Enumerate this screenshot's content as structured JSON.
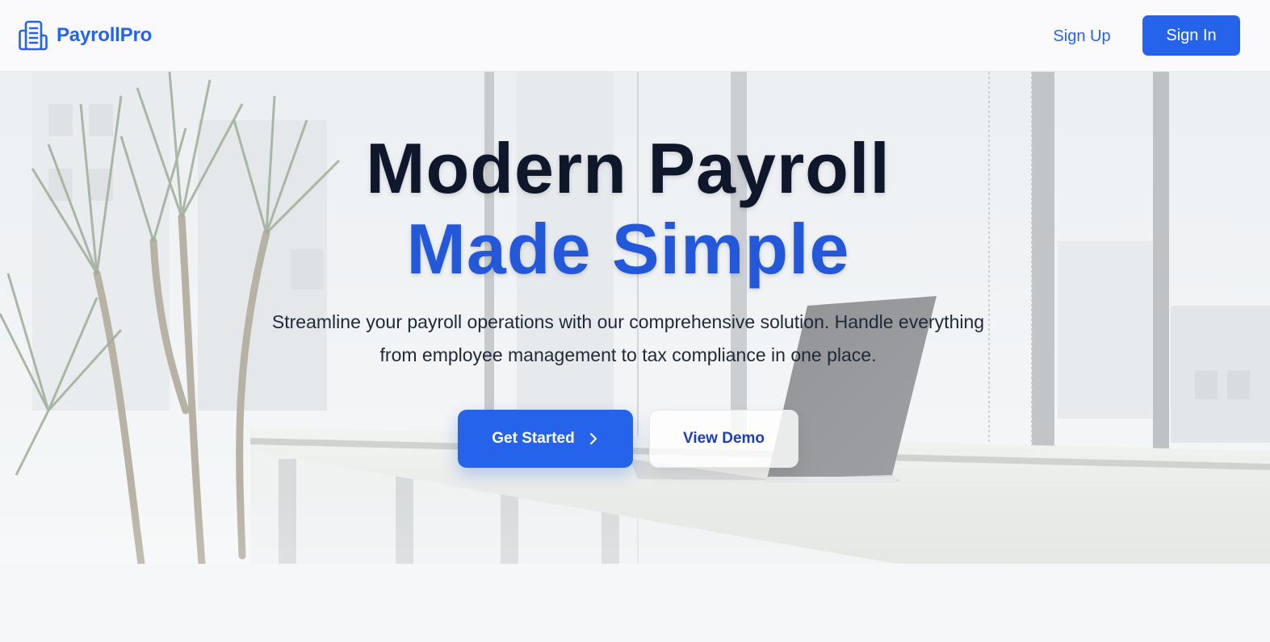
{
  "brand": {
    "name": "PayrollPro",
    "icon": "building-icon",
    "color": "#2563eb"
  },
  "nav": {
    "signup_label": "Sign Up",
    "signin_label": "Sign In"
  },
  "hero": {
    "headline_line1": "Modern Payroll",
    "headline_line2": "Made Simple",
    "subtitle": "Streamline your payroll operations with our comprehensive solution. Handle everything from employee management to tax compliance in one place.",
    "primary_cta": "Get Started",
    "primary_cta_icon": "chevron-right-icon",
    "secondary_cta": "View Demo"
  },
  "colors": {
    "accent": "#2563eb",
    "headline_dark": "#0f172a",
    "headline_blue": "#2458da",
    "page_background": "#f6f7f9"
  }
}
